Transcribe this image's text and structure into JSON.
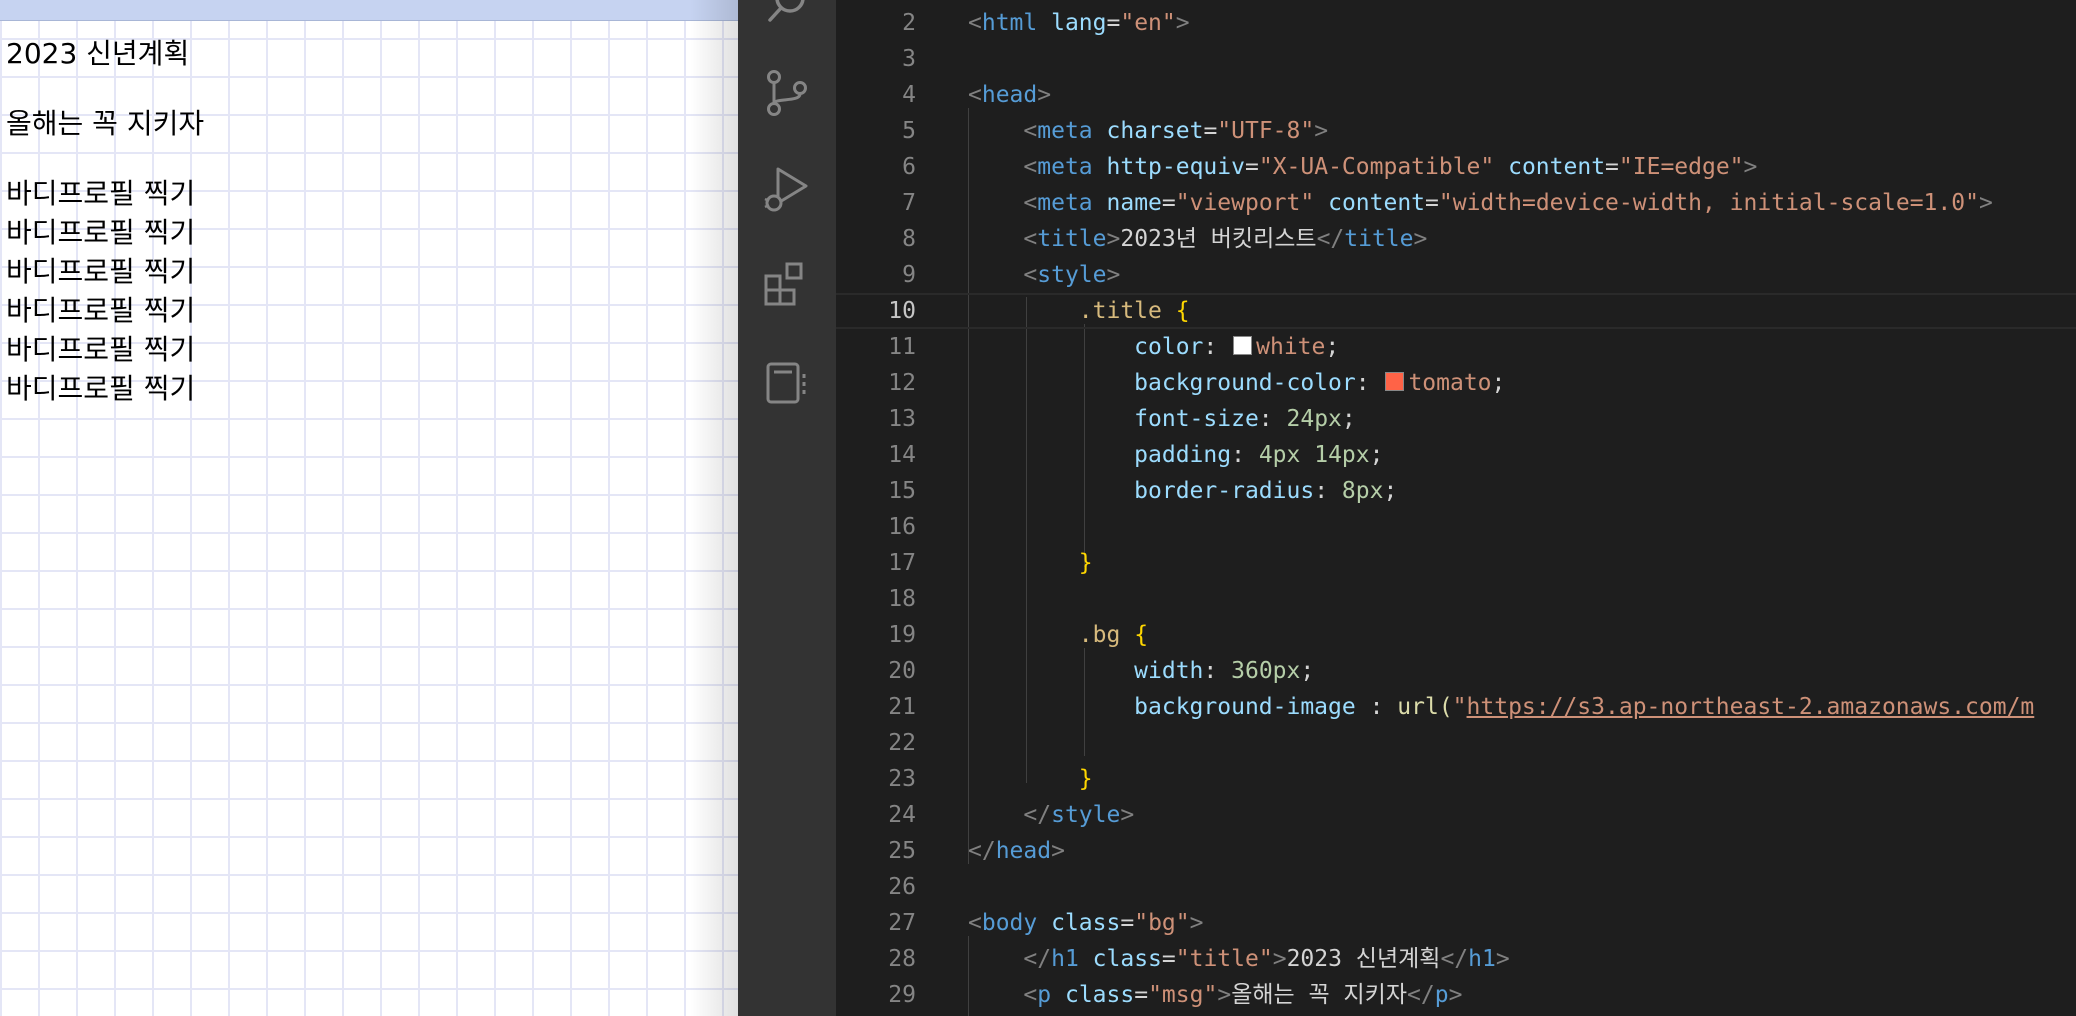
{
  "preview": {
    "title": "2023 신년계획",
    "msg": "올해는 꼭 지키자",
    "items": [
      "바디프로필 찍기",
      "바디프로필 찍기",
      "바디프로필 찍기",
      "바디프로필 찍기",
      "바디프로필 찍기",
      "바디프로필 찍기"
    ]
  },
  "activity_bar": {
    "icons": [
      "search-icon",
      "source-control-icon",
      "run-debug-icon",
      "extensions-icon",
      "notebook-icon"
    ]
  },
  "editor": {
    "active_line": "10",
    "colors": {
      "white": "#ffffff",
      "tomato": "#ff6347"
    },
    "lines": [
      {
        "n": "2",
        "t": "<html lang=\"en\">"
      },
      {
        "n": "3",
        "t": ""
      },
      {
        "n": "4",
        "t": "<head>"
      },
      {
        "n": "5",
        "t": "    <meta charset=\"UTF-8\">"
      },
      {
        "n": "6",
        "t": "    <meta http-equiv=\"X-UA-Compatible\" content=\"IE=edge\">"
      },
      {
        "n": "7",
        "t": "    <meta name=\"viewport\" content=\"width=device-width, initial-scale=1.0\">"
      },
      {
        "n": "8",
        "t": "    <title>2023년 버킷리스트</title>"
      },
      {
        "n": "9",
        "t": "    <style>"
      },
      {
        "n": "10",
        "t": "        .title {"
      },
      {
        "n": "11",
        "t": "            color: white;"
      },
      {
        "n": "12",
        "t": "            background-color: tomato;"
      },
      {
        "n": "13",
        "t": "            font-size: 24px;"
      },
      {
        "n": "14",
        "t": "            padding: 4px 14px;"
      },
      {
        "n": "15",
        "t": "            border-radius: 8px;"
      },
      {
        "n": "16",
        "t": ""
      },
      {
        "n": "17",
        "t": "        }"
      },
      {
        "n": "18",
        "t": ""
      },
      {
        "n": "19",
        "t": "        .bg {"
      },
      {
        "n": "20",
        "t": "            width: 360px;"
      },
      {
        "n": "21",
        "t": "            background-image : url(\"https://s3.ap-northeast-2.amazonaws.com/m"
      },
      {
        "n": "22",
        "t": ""
      },
      {
        "n": "23",
        "t": "        }"
      },
      {
        "n": "24",
        "t": "    </style>"
      },
      {
        "n": "25",
        "t": "</head>"
      },
      {
        "n": "26",
        "t": ""
      },
      {
        "n": "27",
        "t": "<body class=\"bg\">"
      },
      {
        "n": "28",
        "t": "    </h1 class=\"title\">2023 신년계획</h1>"
      },
      {
        "n": "29",
        "t": "    <p class=\"msg\">올해는 꼭 지키자</p>"
      }
    ]
  }
}
